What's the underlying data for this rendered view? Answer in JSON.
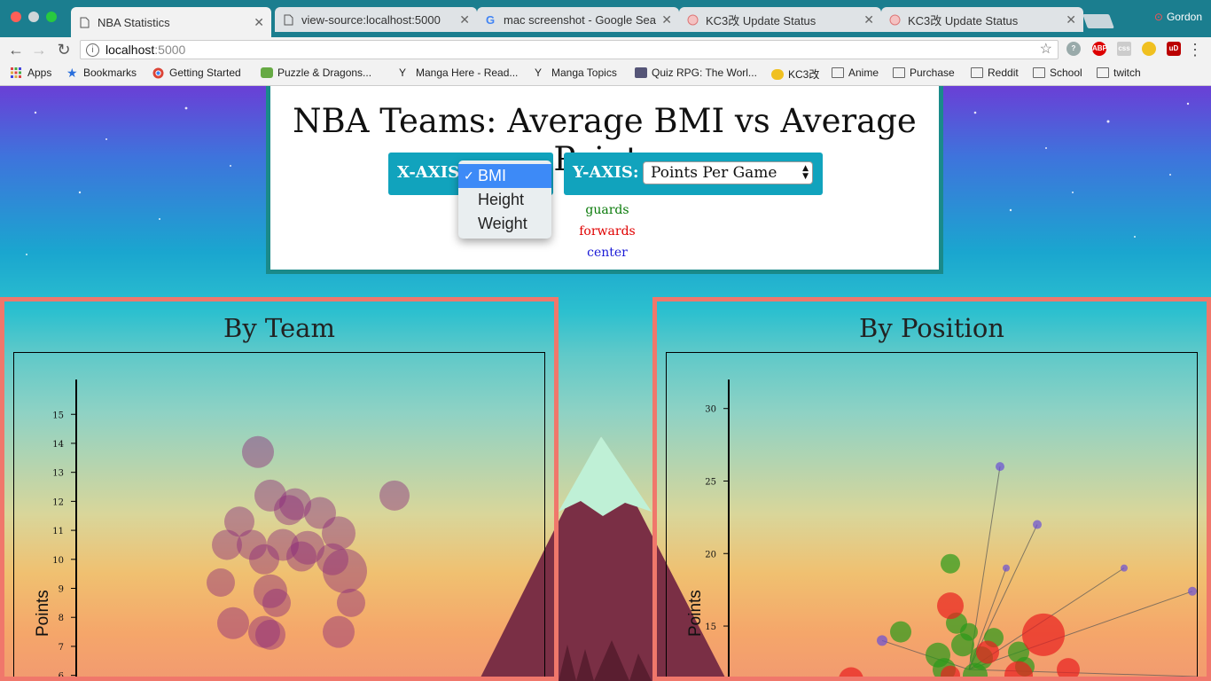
{
  "browser": {
    "tabs": [
      {
        "label": "NBA Statistics",
        "icon": "page-icon",
        "active": true
      },
      {
        "label": "view-source:localhost:5000",
        "icon": "page-icon",
        "active": false
      },
      {
        "label": "mac screenshot - Google Sear",
        "icon": "google-icon",
        "active": false
      },
      {
        "label": "KC3改 Update Status",
        "icon": "kc3-icon",
        "active": false
      },
      {
        "label": "KC3改 Update Status",
        "icon": "kc3-icon",
        "active": false
      }
    ],
    "profile_name": "Gordon",
    "url_host": "localhost",
    "url_port": ":5000",
    "bookmarks": [
      {
        "label": "Apps",
        "icon": "apps-grid-icon"
      },
      {
        "label": "Bookmarks",
        "icon": "star-icon"
      },
      {
        "label": "Getting Started",
        "icon": "chrome-icon"
      },
      {
        "label": "Puzzle & Dragons...",
        "icon": "pad-icon"
      },
      {
        "label": "Manga Here - Read...",
        "icon": "manga-icon"
      },
      {
        "label": "Manga Topics",
        "icon": "manga-icon"
      },
      {
        "label": "Quiz RPG: The Worl...",
        "icon": "quiz-icon"
      },
      {
        "label": "KC3改",
        "icon": "kc3-icon"
      },
      {
        "label": "Anime",
        "icon": "folder-icon"
      },
      {
        "label": "Purchase",
        "icon": "folder-icon"
      },
      {
        "label": "Reddit",
        "icon": "folder-icon"
      },
      {
        "label": "School",
        "icon": "folder-icon"
      },
      {
        "label": "twitch",
        "icon": "folder-icon"
      }
    ],
    "extensions": [
      "shield-icon",
      "abp-icon",
      "css-icon",
      "kc3-icon",
      "ublock-icon"
    ]
  },
  "header": {
    "title": "NBA Teams: Average BMI vs Average Points",
    "x_axis_label": "X-AXIS:",
    "y_axis_label": "Y-AXIS:",
    "x_options": [
      "BMI",
      "Height",
      "Weight"
    ],
    "x_selected": "BMI",
    "y_selected": "Points Per Game",
    "legend": [
      {
        "label": "guards",
        "color": "#0a7a0a"
      },
      {
        "label": "forwards",
        "color": "#e00000"
      },
      {
        "label": "center",
        "color": "#1a1ad6"
      }
    ]
  },
  "charts": {
    "by_team": {
      "title": "By Team",
      "ylabel": "Points"
    },
    "by_position": {
      "title": "By Position",
      "ylabel": "Points"
    }
  },
  "chart_data": [
    {
      "type": "scatter",
      "title": "By Team",
      "ylabel": "Points",
      "xlabel": "",
      "ylim": [
        5.5,
        16.2
      ],
      "y_ticks": [
        6,
        7,
        8,
        9,
        10,
        11,
        12,
        13,
        14,
        15
      ],
      "color": "#8b2a7a",
      "points": [
        {
          "x": 23.5,
          "y": 13.7,
          "r": 18
        },
        {
          "x": 25.7,
          "y": 12.2,
          "r": 17
        },
        {
          "x": 23.7,
          "y": 12.2,
          "r": 18
        },
        {
          "x": 24.1,
          "y": 11.9,
          "r": 18
        },
        {
          "x": 24.0,
          "y": 11.7,
          "r": 17
        },
        {
          "x": 24.5,
          "y": 11.6,
          "r": 18
        },
        {
          "x": 23.2,
          "y": 11.3,
          "r": 17
        },
        {
          "x": 24.8,
          "y": 10.9,
          "r": 19
        },
        {
          "x": 23.0,
          "y": 10.5,
          "r": 17
        },
        {
          "x": 23.4,
          "y": 10.5,
          "r": 17
        },
        {
          "x": 23.9,
          "y": 10.5,
          "r": 18
        },
        {
          "x": 24.3,
          "y": 10.4,
          "r": 19
        },
        {
          "x": 24.2,
          "y": 10.1,
          "r": 17
        },
        {
          "x": 23.6,
          "y": 10.0,
          "r": 17
        },
        {
          "x": 24.7,
          "y": 10.0,
          "r": 18
        },
        {
          "x": 24.9,
          "y": 9.6,
          "r": 25
        },
        {
          "x": 22.9,
          "y": 9.2,
          "r": 16
        },
        {
          "x": 23.7,
          "y": 8.9,
          "r": 19
        },
        {
          "x": 23.8,
          "y": 8.5,
          "r": 16
        },
        {
          "x": 25.0,
          "y": 8.5,
          "r": 16
        },
        {
          "x": 23.1,
          "y": 7.8,
          "r": 18
        },
        {
          "x": 23.6,
          "y": 7.5,
          "r": 18
        },
        {
          "x": 24.8,
          "y": 7.5,
          "r": 18
        },
        {
          "x": 23.7,
          "y": 7.4,
          "r": 17
        }
      ]
    },
    {
      "type": "scatter",
      "title": "By Position",
      "ylabel": "Points",
      "xlabel": "",
      "ylim": [
        10.6,
        32
      ],
      "y_ticks": [
        15,
        20,
        25,
        30
      ],
      "series": [
        {
          "name": "center",
          "color": "#6a4fd6",
          "points": [
            {
              "x": 24.8,
              "y": 26.0,
              "r": 5
            },
            {
              "x": 25.4,
              "y": 22.0,
              "r": 5
            },
            {
              "x": 24.9,
              "y": 19.0,
              "r": 4
            },
            {
              "x": 26.8,
              "y": 19.0,
              "r": 4
            },
            {
              "x": 27.9,
              "y": 17.4,
              "r": 5
            },
            {
              "x": 22.9,
              "y": 14.0,
              "r": 6
            },
            {
              "x": 28.1,
              "y": 11.5,
              "r": 6
            }
          ]
        },
        {
          "name": "guards",
          "color": "#2a9a1a",
          "points": [
            {
              "x": 24.0,
              "y": 19.3,
              "r": 11
            },
            {
              "x": 23.2,
              "y": 14.6,
              "r": 12
            },
            {
              "x": 24.1,
              "y": 15.2,
              "r": 12
            },
            {
              "x": 24.3,
              "y": 14.6,
              "r": 10
            },
            {
              "x": 24.7,
              "y": 14.2,
              "r": 11
            },
            {
              "x": 24.2,
              "y": 13.7,
              "r": 13
            },
            {
              "x": 23.8,
              "y": 13.0,
              "r": 14
            },
            {
              "x": 24.5,
              "y": 12.8,
              "r": 13
            },
            {
              "x": 25.1,
              "y": 13.2,
              "r": 12
            },
            {
              "x": 23.9,
              "y": 12.0,
              "r": 13
            },
            {
              "x": 24.4,
              "y": 11.6,
              "r": 14
            },
            {
              "x": 25.2,
              "y": 12.2,
              "r": 11
            }
          ]
        },
        {
          "name": "forwards",
          "color": "#e82020",
          "points": [
            {
              "x": 24.0,
              "y": 16.4,
              "r": 15
            },
            {
              "x": 25.5,
              "y": 14.4,
              "r": 24
            },
            {
              "x": 24.6,
              "y": 13.2,
              "r": 13
            },
            {
              "x": 25.1,
              "y": 11.6,
              "r": 16
            },
            {
              "x": 25.9,
              "y": 12.0,
              "r": 13
            },
            {
              "x": 22.4,
              "y": 11.3,
              "r": 14
            },
            {
              "x": 24.0,
              "y": 11.6,
              "r": 11
            }
          ]
        }
      ]
    }
  ]
}
